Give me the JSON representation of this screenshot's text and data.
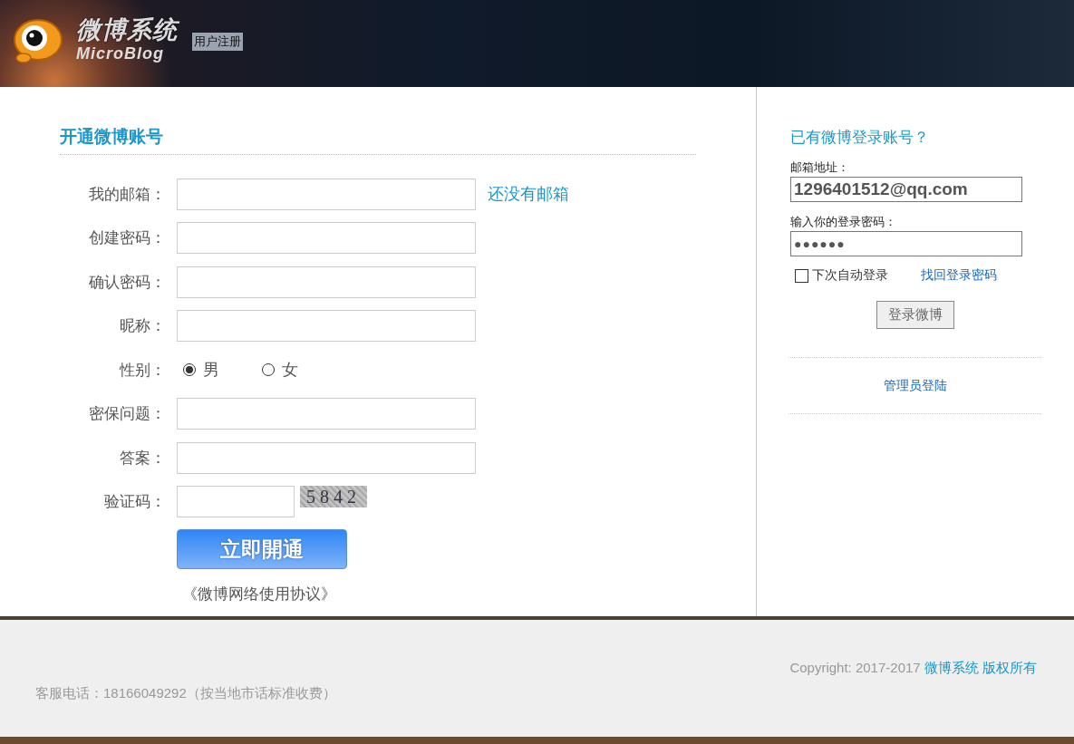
{
  "header": {
    "logo_title": "微博系统",
    "logo_subtitle": "MicroBlog",
    "page_title": "用户注册"
  },
  "register": {
    "title": "开通微博账号",
    "fields": [
      {
        "kind": "text",
        "label": "我的邮箱：",
        "link": "还没有邮箱"
      },
      {
        "kind": "text",
        "label": "创建密码："
      },
      {
        "kind": "text",
        "label": "确认密码："
      },
      {
        "kind": "text",
        "label": "昵称："
      },
      {
        "kind": "radio",
        "label": "性别：",
        "options": [
          {
            "label": "男",
            "selected": true
          },
          {
            "label": "女",
            "selected": false
          }
        ]
      },
      {
        "kind": "text",
        "label": "密保问题："
      },
      {
        "kind": "text",
        "label": "答案："
      },
      {
        "kind": "captcha",
        "label": "验证码：",
        "captcha": "5842"
      }
    ],
    "submit": "立即開通",
    "agreement": "《微博网络使用协议》"
  },
  "login": {
    "title": "已有微博登录账号？",
    "email_label": "邮箱地址：",
    "email_value": "1296401512@qq.com",
    "password_label": "输入你的登录密码：",
    "password_mask": "●●●●●●",
    "remember": {
      "label": "下次自动登录",
      "checked": false
    },
    "forgot": "找回登录密码",
    "button": "登录微博",
    "admin": "管理员登陆"
  },
  "footer": {
    "copyright": "Copyright: 2017-2017",
    "owner": "微博系统 版权所有",
    "phone": "客服电话：18166049292（按当地市话标准收费）"
  }
}
